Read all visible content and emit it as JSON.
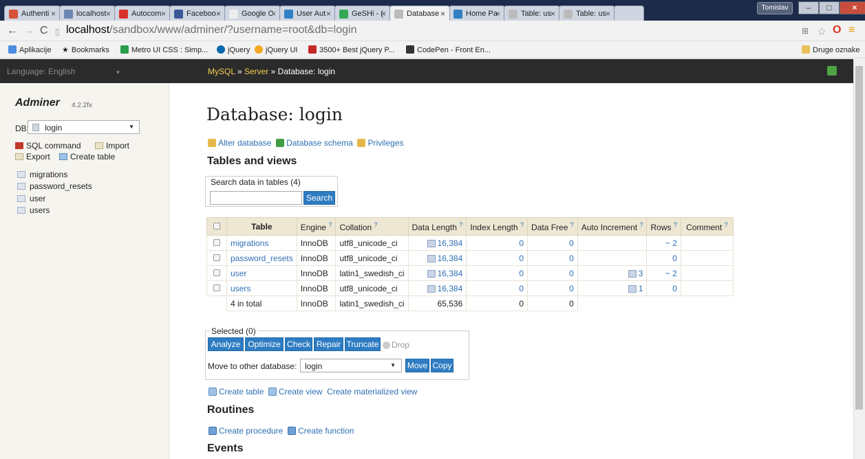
{
  "browser": {
    "tabs": [
      {
        "label": "Authenti",
        "color": "#d6513a"
      },
      {
        "label": "localhost",
        "color": "#6c87b4"
      },
      {
        "label": "Autocom",
        "color": "#d9322a"
      },
      {
        "label": "Faceboo",
        "color": "#3b5998"
      },
      {
        "label": "Google C",
        "color": "#eeeeee"
      },
      {
        "label": "User Aut",
        "color": "#2f7fc3"
      },
      {
        "label": "GeSHi - (",
        "color": "#34a853"
      },
      {
        "label": "Database",
        "color": "#aaaaaa"
      },
      {
        "label": "Home Pa",
        "color": "#2f7fc3"
      },
      {
        "label": "Table: us",
        "color": "#aaaaaa"
      },
      {
        "label": "Table: us",
        "color": "#aaaaaa"
      }
    ],
    "user": "Tomislav",
    "url_host": "localhost",
    "url_path": "/sandbox/www/adminer/?username=root&db=login",
    "bookmarks": [
      {
        "label": "Aplikacije",
        "color": "#4f8de0"
      },
      {
        "label": "Bookmarks",
        "color": "#555555"
      },
      {
        "label": "Metro UI CSS : Simp...",
        "color": "#2a9d4b"
      },
      {
        "label": "jQuery",
        "color": "#0868ac"
      },
      {
        "label": "jQuery UI",
        "color": "#f5a623"
      },
      {
        "label": "3500+ Best jQuery P...",
        "color": "#c62828"
      },
      {
        "label": "CodePen - Front En...",
        "color": "#333333"
      }
    ],
    "other_bookmarks": "Druge oznake"
  },
  "header": {
    "language_label": "Language:",
    "language_value": "English",
    "crumb_mysql": "MySQL",
    "crumb_server": "Server",
    "crumb_db": "Database: login",
    "sep": "»"
  },
  "sidebar": {
    "logo": "Adminer",
    "version": "4.2.2fx",
    "db_label": "DB:",
    "db_value": "login",
    "sql_command": "SQL command",
    "import": "Import",
    "export": "Export",
    "create_table": "Create table",
    "tables": [
      "migrations",
      "password_resets",
      "user",
      "users"
    ]
  },
  "main": {
    "title": "Database: login",
    "alter_database": "Alter database",
    "database_schema": "Database schema",
    "privileges": "Privileges",
    "tables_heading": "Tables and views",
    "search_legend": "Search data in tables (4)",
    "search_button": "Search",
    "columns": {
      "table": "Table",
      "engine": "Engine",
      "collation": "Collation",
      "data_length": "Data Length",
      "index_length": "Index Length",
      "data_free": "Data Free",
      "auto_increment": "Auto Increment",
      "rows": "Rows",
      "comment": "Comment"
    },
    "help": "?",
    "rows": [
      {
        "name": "migrations",
        "engine": "InnoDB",
        "collation": "utf8_unicode_ci",
        "data_length": "16,384",
        "index_length": "0",
        "data_free": "0",
        "auto_increment": "",
        "rows": "~ 2"
      },
      {
        "name": "password_resets",
        "engine": "InnoDB",
        "collation": "utf8_unicode_ci",
        "data_length": "16,384",
        "index_length": "0",
        "data_free": "0",
        "auto_increment": "",
        "rows": "0"
      },
      {
        "name": "user",
        "engine": "InnoDB",
        "collation": "latin1_swedish_ci",
        "data_length": "16,384",
        "index_length": "0",
        "data_free": "0",
        "auto_increment": "3",
        "rows": "~ 2"
      },
      {
        "name": "users",
        "engine": "InnoDB",
        "collation": "utf8_unicode_ci",
        "data_length": "16,384",
        "index_length": "0",
        "data_free": "0",
        "auto_increment": "1",
        "rows": "0"
      }
    ],
    "total": {
      "name": "4 in total",
      "engine": "InnoDB",
      "collation": "latin1_swedish_ci",
      "data_length": "65,536",
      "index_length": "0",
      "data_free": "0"
    },
    "selected_legend": "Selected (0)",
    "buttons": {
      "analyze": "Analyze",
      "optimize": "Optimize",
      "check": "Check",
      "repair": "Repair",
      "truncate": "Truncate",
      "drop": "Drop"
    },
    "move_label": "Move to other database:",
    "move_value": "login",
    "move_button": "Move",
    "copy_button": "Copy",
    "create_table": "Create table",
    "create_view": "Create view",
    "create_materialized_view": "Create materialized view",
    "routines_heading": "Routines",
    "create_procedure": "Create procedure",
    "create_function": "Create function",
    "events_heading": "Events"
  }
}
